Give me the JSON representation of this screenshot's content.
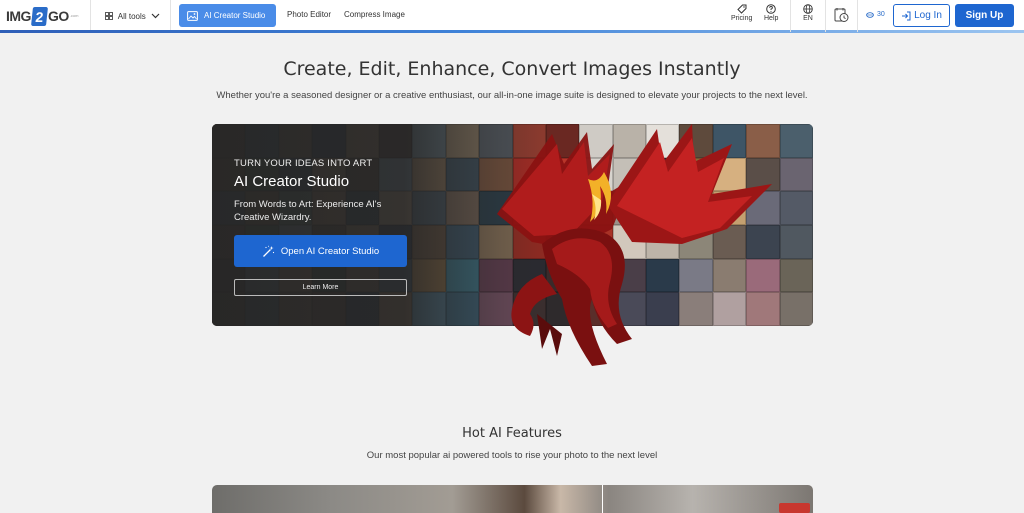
{
  "header": {
    "logo": {
      "part1": "IMG",
      "part2": "2",
      "part3": "GO",
      "suffix": ".com"
    },
    "all_tools_label": "All tools",
    "nav": {
      "ai_creator": "AI Creator Studio",
      "photo_editor": "Photo Editor",
      "compress": "Compress Image"
    },
    "pricing_label": "Pricing",
    "help_label": "Help",
    "language_label": "EN",
    "credits": "30",
    "login_label": "Log In",
    "signup_label": "Sign Up"
  },
  "hero": {
    "title": "Create, Edit, Enhance, Convert Images Instantly",
    "subtitle": "Whether you're a seasoned designer or a creative enthusiast, our all-in-one image suite is designed to elevate your projects to the next level."
  },
  "banner": {
    "kicker": "TURN YOUR IDEAS INTO ART",
    "title": "AI Creator Studio",
    "description": "From Words to Art: Experience AI's Creative Wizardry.",
    "cta_label": "Open AI Creator Studio",
    "learn_more_label": "Learn More"
  },
  "features": {
    "title": "Hot AI Features",
    "subtitle": "Our most popular ai powered tools to rise your photo to the next level"
  },
  "colors": {
    "primary": "#1e66d0",
    "active_nav": "#4a8ce8",
    "background": "#f1f1f1"
  }
}
